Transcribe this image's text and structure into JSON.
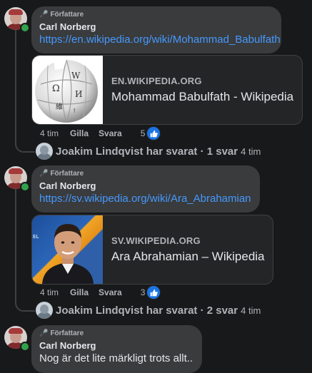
{
  "comments": [
    {
      "author_tag": "Författare",
      "author": "Carl Norberg",
      "link_text": "https://en.wikipedia.org/wiki/Mohammad_Babulfath",
      "card": {
        "domain": "EN.WIKIPEDIA.ORG",
        "title": "Mohammad Babulfath - Wikipedia",
        "thumb_icon": "wikipedia-globe-logo"
      },
      "time": "4 tim",
      "like_label": "Gilla",
      "reply_label": "Svara",
      "reactions": "5",
      "reply_summary": {
        "text": "Joakim Lindqvist har svarat · 1 svar",
        "time": "4 tim"
      }
    },
    {
      "author_tag": "Författare",
      "author": "Carl Norberg",
      "link_text": "https://sv.wikipedia.org/wiki/Ara_Abrahamian",
      "card": {
        "domain": "SV.WIKIPEDIA.ORG",
        "title": "Ara Abrahamian – Wikipedia",
        "thumb_icon": "person-photo"
      },
      "time": "4 tim",
      "like_label": "Gilla",
      "reply_label": "Svara",
      "reactions": "3",
      "reply_summary": {
        "text": "Joakim Lindqvist har svarat · 2 svar",
        "time": "4 tim"
      }
    },
    {
      "author_tag": "Författare",
      "author": "Carl Norberg",
      "text": "Nog är det lite märkligt trots allt.."
    }
  ],
  "colors": {
    "background": "#18191a",
    "bubble": "#3a3b3c",
    "link": "#4599ff",
    "like": "#1b74e4",
    "online": "#31a24c"
  }
}
